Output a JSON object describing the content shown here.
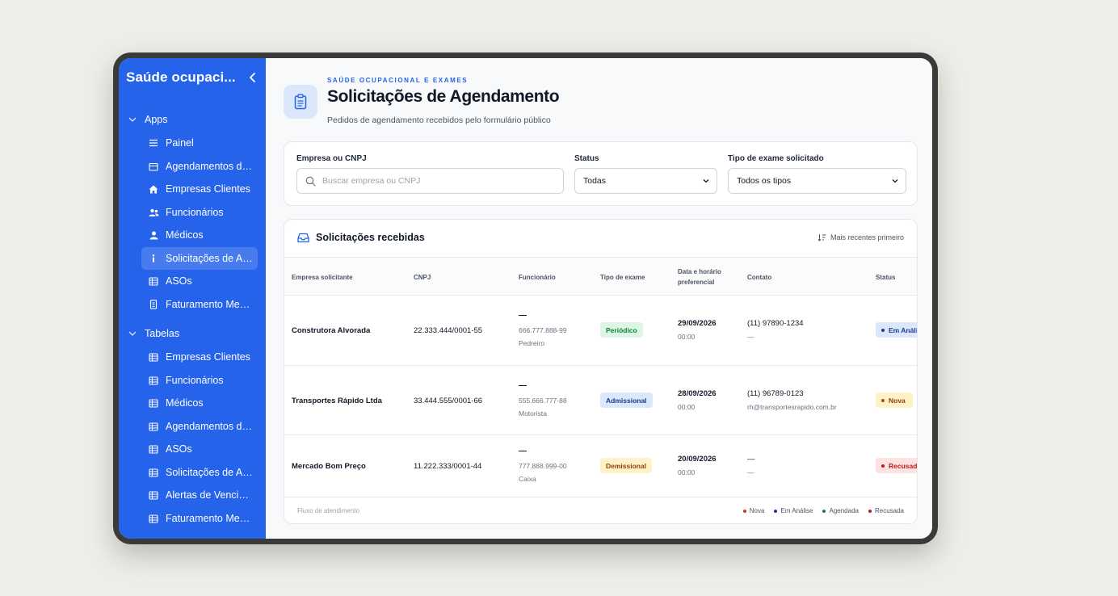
{
  "sidebar": {
    "title": "Saúde ocupaci...",
    "groups": [
      {
        "label": "Apps",
        "items": [
          {
            "label": "Painel",
            "icon": "list-icon"
          },
          {
            "label": "Agendamentos de...",
            "icon": "calendar-icon"
          },
          {
            "label": "Empresas Clientes",
            "icon": "home-icon"
          },
          {
            "label": "Funcionários",
            "icon": "users-icon"
          },
          {
            "label": "Médicos",
            "icon": "user-icon"
          },
          {
            "label": "Solicitações de Ag...",
            "icon": "info-icon",
            "active": true
          },
          {
            "label": "ASOs",
            "icon": "table-icon"
          },
          {
            "label": "Faturamento Men...",
            "icon": "file-icon"
          }
        ]
      },
      {
        "label": "Tabelas",
        "items": [
          {
            "label": "Empresas Clientes",
            "icon": "table-icon"
          },
          {
            "label": "Funcionários",
            "icon": "table-icon"
          },
          {
            "label": "Médicos",
            "icon": "table-icon"
          },
          {
            "label": "Agendamentos de...",
            "icon": "table-icon"
          },
          {
            "label": "ASOs",
            "icon": "table-icon"
          },
          {
            "label": "Solicitações de Ag...",
            "icon": "table-icon"
          },
          {
            "label": "Alertas de Vencim...",
            "icon": "table-icon"
          },
          {
            "label": "Faturamento Men...",
            "icon": "table-icon"
          }
        ]
      }
    ]
  },
  "header": {
    "eyebrow": "SAÚDE OCUPACIONAL E EXAMES",
    "title": "Solicitações de Agendamento",
    "subtitle": "Pedidos de agendamento recebidos pelo formulário público"
  },
  "filters": {
    "company_label": "Empresa ou CNPJ",
    "company_placeholder": "Buscar empresa ou CNPJ",
    "status_label": "Status",
    "status_value": "Todas",
    "exam_label": "Tipo de exame solicitado",
    "exam_value": "Todos os tipos"
  },
  "list": {
    "title": "Solicitações recebidas",
    "sort_label": "Mais recentes primeiro",
    "columns": [
      "Empresa solicitante",
      "CNPJ",
      "Funcionário",
      "Tipo de exame",
      "Data e horário preferencial",
      "Contato",
      "Status"
    ],
    "rows": [
      {
        "company": "Construtora Alvorada",
        "cnpj": "22.333.444/0001-55",
        "employee_name": "—",
        "employee_cpf": "666.777.888-99",
        "employee_role": "Pedreiro",
        "exam": "Periódico",
        "date": "29/09/2026",
        "time": "00:00",
        "phone": "(11) 97890-1234",
        "email": "—",
        "status": "Em Análise"
      },
      {
        "company": "Transportes Rápido Ltda",
        "cnpj": "33.444.555/0001-66",
        "employee_name": "—",
        "employee_cpf": "555.666.777-88",
        "employee_role": "Motorista",
        "exam": "Admissional",
        "date": "28/09/2026",
        "time": "00:00",
        "phone": "(11) 96789-0123",
        "email": "rh@transportesrapido.com.br",
        "status": "Nova"
      },
      {
        "company": "Mercado Bom Preço",
        "cnpj": "11.222.333/0001-44",
        "employee_name": "—",
        "employee_cpf": "777.888.999-00",
        "employee_role": "Caixa",
        "exam": "Demissional",
        "date": "20/09/2026",
        "time": "00:00",
        "phone": "—",
        "email": "—",
        "status": "Recusada"
      }
    ],
    "footer_label": "Fluxo de atendimento",
    "legend": [
      "Nova",
      "Em Análise",
      "Agendada",
      "Recusada"
    ]
  },
  "colors": {
    "sidebar": "#2563eb",
    "accent": "#2563eb",
    "nova": "#c2410c",
    "em_analise": "#1e3a8a",
    "agendada": "#15803d",
    "recusada": "#b91c1c"
  }
}
